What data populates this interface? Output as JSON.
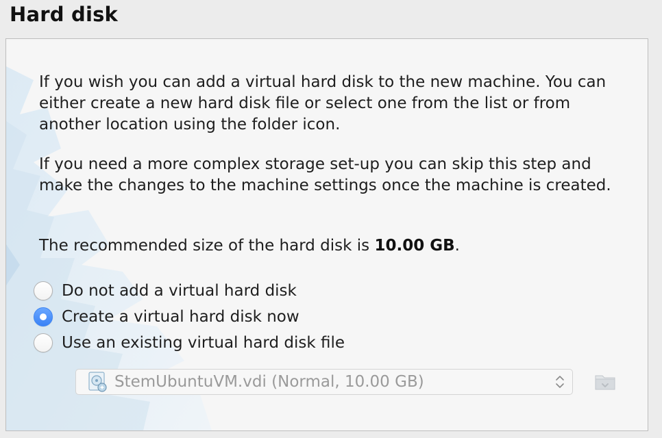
{
  "page": {
    "title": "Hard disk"
  },
  "info": {
    "paragraph1": "If you wish you can add a virtual hard disk to the new machine. You can either create a new hard disk file or select one from the list or from another location using the folder icon.",
    "paragraph2": "If you need a more complex storage set-up you can skip this step and make the changes to the machine settings once the machine is created.",
    "recommended_prefix": "The recommended size of the hard disk is ",
    "recommended_size": "10.00 GB",
    "recommended_suffix": "."
  },
  "options": [
    {
      "label": "Do not add a virtual hard disk",
      "selected": false
    },
    {
      "label": "Create a virtual hard disk now",
      "selected": true
    },
    {
      "label": "Use an existing virtual hard disk file",
      "selected": false
    }
  ],
  "disk_select": {
    "value": "StemUbuntuVM.vdi (Normal, 10.00 GB)",
    "icon": "virtual-disk-icon",
    "enabled": false
  },
  "folder_button": {
    "icon": "folder-icon",
    "enabled": false
  },
  "colors": {
    "accent": "#3a82f6",
    "panel_background": "#f6f6f6",
    "window_background": "#ececec"
  }
}
